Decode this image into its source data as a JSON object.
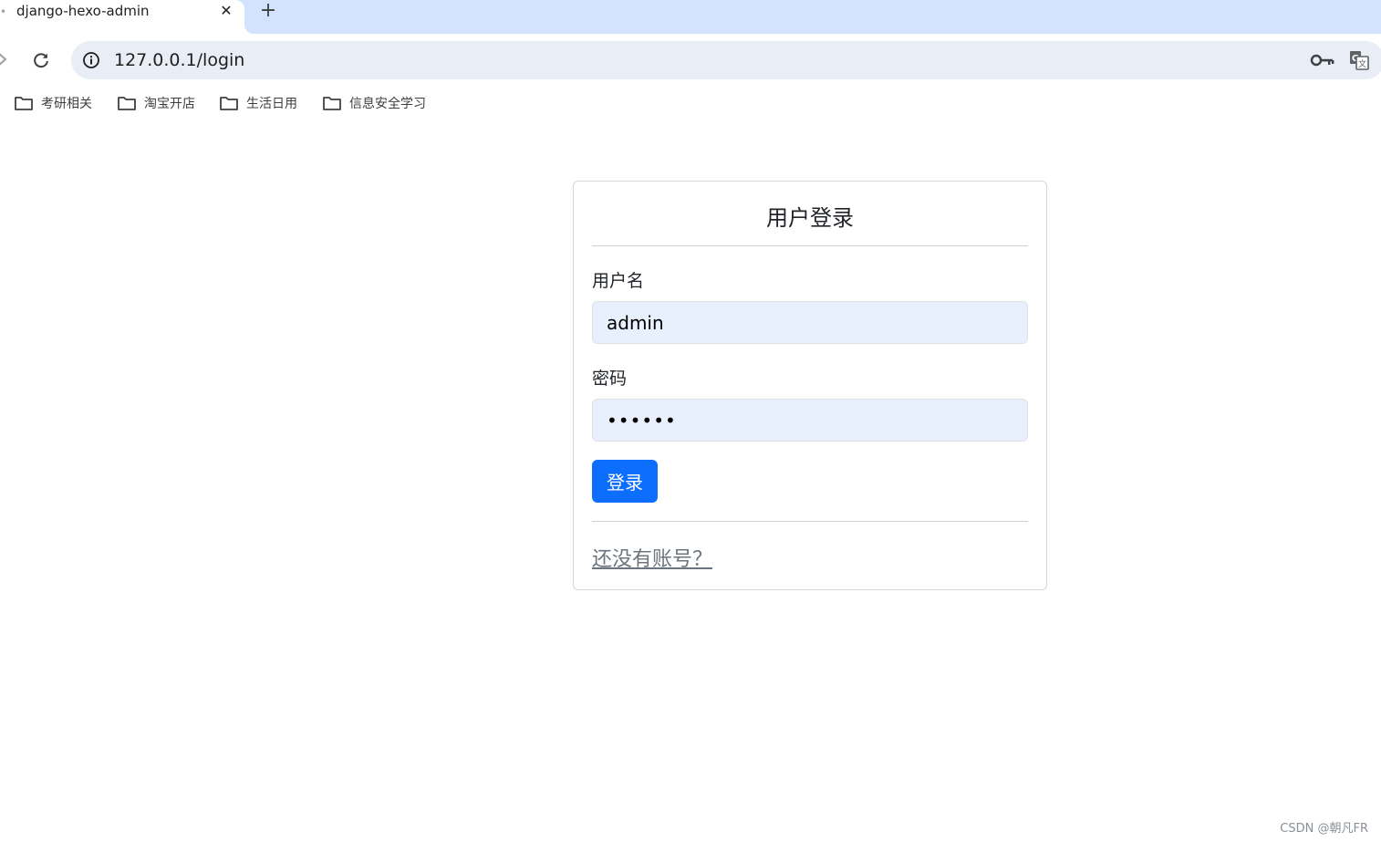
{
  "browser": {
    "tab": {
      "title": "django-hexo-admin",
      "close_glyph": "✕"
    },
    "new_tab_glyph": "+",
    "address_bar": {
      "url": "127.0.0.1/login"
    },
    "icons": {
      "forward": "forward-arrow-icon",
      "reload": "reload-icon",
      "site_info": "info-icon",
      "password": "key-icon",
      "translate": "translate-icon",
      "bookmark_folder": "folder-icon"
    },
    "bookmarks": [
      {
        "label": "考研相关"
      },
      {
        "label": "淘宝开店"
      },
      {
        "label": "生活日用"
      },
      {
        "label": "信息安全学习"
      }
    ]
  },
  "login_form": {
    "title": "用户登录",
    "username": {
      "label": "用户名",
      "value": "admin"
    },
    "password": {
      "label": "密码",
      "value": "••••••"
    },
    "submit_label": "登录",
    "register_link": "还没有账号？"
  },
  "watermark": "CSDN @朝凡FR",
  "colors": {
    "tabstrip": "#d3e3fd",
    "omnibox": "#e9eef6",
    "input_autofill": "#e8f0fe",
    "primary_button": "#0d6efd",
    "link_muted": "#6c757d"
  }
}
